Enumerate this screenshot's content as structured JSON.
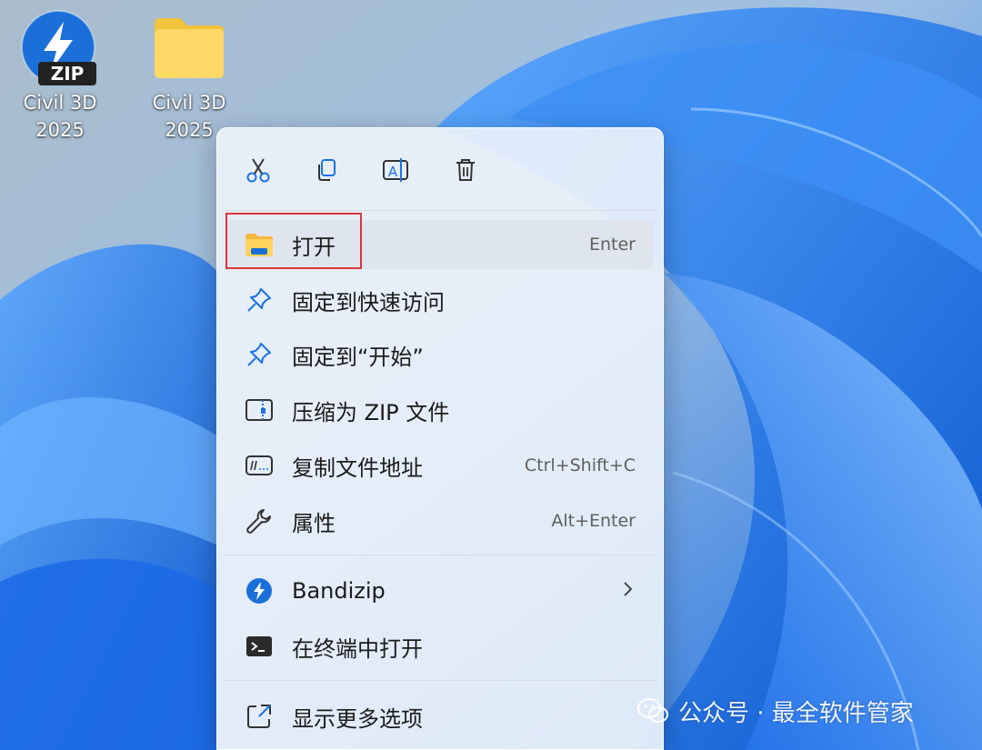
{
  "desktop": {
    "icons": [
      {
        "name": "zip-file",
        "line1": "Civil 3D",
        "line2": "2025",
        "badge": "ZIP"
      },
      {
        "name": "folder",
        "line1": "Civil 3D",
        "line2": "2025"
      }
    ]
  },
  "context_menu": {
    "toolbar": [
      {
        "icon": "scissors-icon",
        "action": "cut"
      },
      {
        "icon": "copy-icon",
        "action": "copy"
      },
      {
        "icon": "rename-icon",
        "action": "rename"
      },
      {
        "icon": "trash-icon",
        "action": "delete"
      }
    ],
    "items": [
      {
        "label": "打开",
        "shortcut": "Enter",
        "icon": "folder-open-icon",
        "highlighted": true
      },
      {
        "label": "固定到快速访问",
        "shortcut": "",
        "icon": "pin-icon"
      },
      {
        "label": "固定到“开始”",
        "shortcut": "",
        "icon": "pin-icon"
      },
      {
        "label": "压缩为 ZIP 文件",
        "shortcut": "",
        "icon": "zip-archive-icon"
      },
      {
        "label": "复制文件地址",
        "shortcut": "Ctrl+Shift+C",
        "icon": "copy-path-icon"
      },
      {
        "label": "属性",
        "shortcut": "Alt+Enter",
        "icon": "wrench-icon"
      },
      {
        "label": "Bandizip",
        "shortcut": "",
        "icon": "bandizip-icon",
        "submenu": true
      },
      {
        "label": "在终端中打开",
        "shortcut": "",
        "icon": "terminal-icon"
      },
      {
        "label": "显示更多选项",
        "shortcut": "",
        "icon": "more-options-icon"
      }
    ]
  },
  "watermark": {
    "text": "公众号 · 最全软件管家"
  },
  "colors": {
    "accent": "#1a73e8",
    "highlight_border": "#e0333b",
    "menu_bg": "#ecf2fa"
  }
}
